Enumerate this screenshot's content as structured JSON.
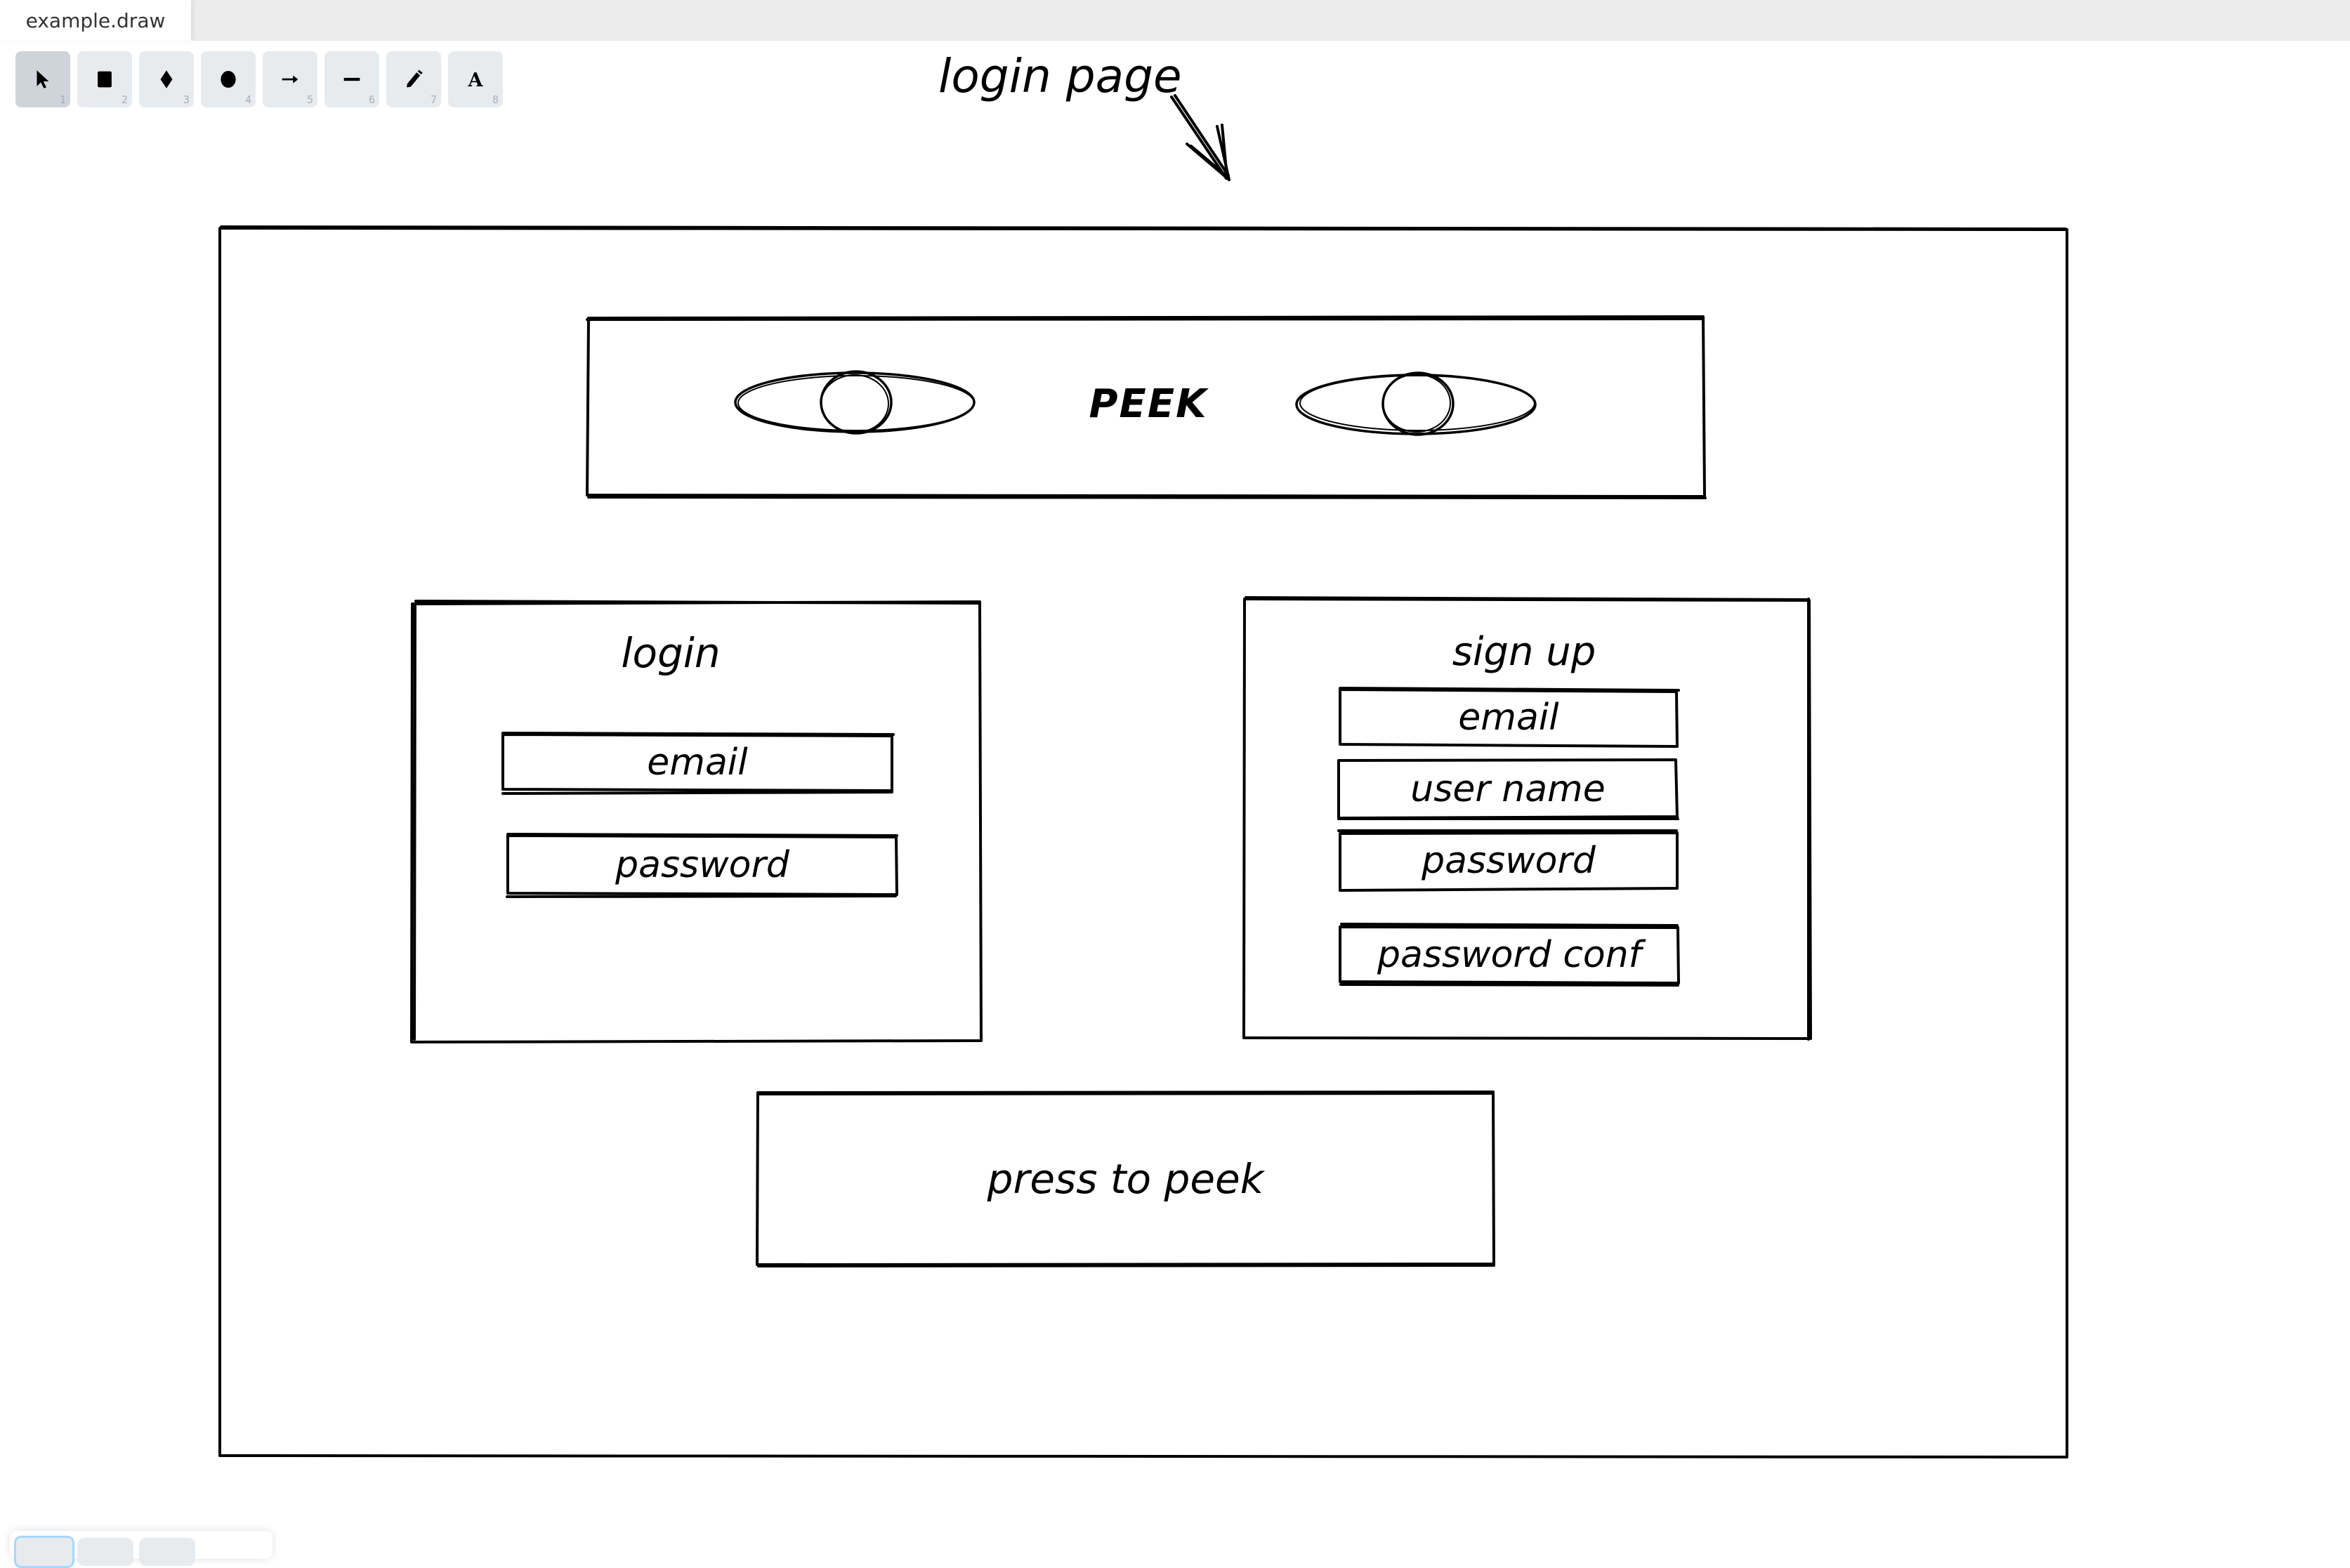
{
  "tab": {
    "title": "example.draw"
  },
  "toolbar": {
    "tools": [
      {
        "name": "select",
        "icon": "cursor-icon",
        "shortcut": "1",
        "active": true
      },
      {
        "name": "rectangle",
        "icon": "rectangle-icon",
        "shortcut": "2",
        "active": false
      },
      {
        "name": "diamond",
        "icon": "diamond-icon",
        "shortcut": "3",
        "active": false
      },
      {
        "name": "ellipse",
        "icon": "ellipse-icon",
        "shortcut": "4",
        "active": false
      },
      {
        "name": "arrow",
        "icon": "arrow-icon",
        "shortcut": "5",
        "active": false
      },
      {
        "name": "line",
        "icon": "line-icon",
        "shortcut": "6",
        "active": false
      },
      {
        "name": "draw",
        "icon": "pencil-icon",
        "shortcut": "7",
        "active": false
      },
      {
        "name": "text",
        "icon": "text-icon",
        "shortcut": "8",
        "active": false
      }
    ]
  },
  "drawing": {
    "annotation": "login page",
    "header_title": "PEEK",
    "login_panel": {
      "title": "login",
      "fields": [
        "email",
        "password"
      ]
    },
    "signup_panel": {
      "title": "sign up",
      "fields": [
        "email",
        "user name",
        "password",
        "password conf"
      ]
    },
    "action_button": "press to peek"
  },
  "colors": {
    "stroke": "#000000",
    "tabbar_bg": "#ececec",
    "tool_bg": "#e8ebee",
    "tool_active_bg": "#cfd4da",
    "slide_active_border": "#a6d8fb"
  }
}
